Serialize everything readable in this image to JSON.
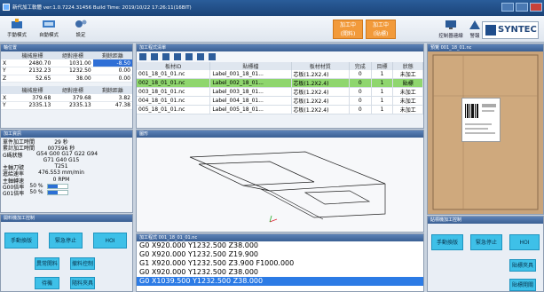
{
  "window": {
    "title": "新代加工軟體 ver:1.0.7224.31456 Build Time: 2019/10/22 17:26:11(16BIT)"
  },
  "toolbar": {
    "buttons": [
      {
        "label": "手動模式",
        "icon": "hand-mode-icon"
      },
      {
        "label": "自動模式",
        "icon": "auto-mode-icon"
      },
      {
        "label": "設定",
        "icon": "gear-icon"
      }
    ],
    "status": [
      {
        "line1": "加工中",
        "line2": "(開料)"
      },
      {
        "label1": "加工中",
        "label2": "(貼標)"
      }
    ],
    "system_buttons": [
      {
        "label": "控制器連線"
      },
      {
        "label": "警報"
      }
    ],
    "logo": "SYNTEC"
  },
  "axis_panel": {
    "title": "軸位置",
    "headers": [
      "",
      "機械座標",
      "絕對座標",
      "剩餘距離"
    ],
    "rows": [
      [
        "X",
        "2480.70",
        "1031.00",
        "-8.50"
      ],
      [
        "Y",
        "2132.23",
        "1232.50",
        "0.00"
      ],
      [
        "Z",
        "52.65",
        "38.00",
        "0.00"
      ]
    ],
    "headers2": [
      "",
      "機械座標",
      "絕對座標",
      "剩餘距離"
    ],
    "rows2": [
      [
        "X",
        "379.68",
        "379.68",
        "3.82"
      ],
      [
        "Y",
        "2335.13",
        "2335.13",
        "47.38"
      ]
    ]
  },
  "process_info": {
    "title": "加工資訊",
    "rows": [
      {
        "k": "單件加工時間",
        "v": "29 秒"
      },
      {
        "k": "累計加工時間",
        "v": "007596 秒"
      },
      {
        "k": "G碼狀態",
        "v": "G54 G00 G17 G22 G94"
      },
      {
        "k": "",
        "v": "G71 G40 G15"
      },
      {
        "k": "主軸刀號",
        "v": "T251"
      },
      {
        "k": "進給速率",
        "v": "476.553 mm/min"
      },
      {
        "k": "主軸轉速",
        "v": "0 RPM"
      },
      {
        "k": "G00倍率",
        "v": "50 %",
        "pct": 50
      },
      {
        "k": "G01倍率",
        "v": "50 %",
        "pct": 50
      }
    ]
  },
  "left_controls": {
    "title": "開料機加工控制",
    "buttons": [
      "手動換版",
      "緊急停止",
      "HOI",
      "異常開料",
      "撤料控制",
      "待機",
      "隨料夾具"
    ]
  },
  "program_list": {
    "title": "加工程式清單",
    "headers": [
      "板材ID",
      "貼標檔",
      "板材材質",
      "完成",
      "目標",
      "狀態"
    ],
    "rows": [
      {
        "id": "001_18_01_01.nc",
        "label": "Label_001_18_01...",
        "mat": "芯板(1.2X2.4)",
        "done": "0",
        "target": "1",
        "status": "未加工",
        "style": "w"
      },
      {
        "id": "002_18_01_01.nc",
        "label": "Label_002_18_01...",
        "mat": "芯板(1.2X2.4)",
        "done": "0",
        "target": "1",
        "status": "貼標",
        "style": "g"
      },
      {
        "id": "003_18_01_01.nc",
        "label": "Label_003_18_01...",
        "mat": "芯板(1.2X2.4)",
        "done": "0",
        "target": "1",
        "status": "未加工",
        "style": "w"
      },
      {
        "id": "004_18_01_01.nc",
        "label": "Label_004_18_01...",
        "mat": "芯板(1.2X2.4)",
        "done": "0",
        "target": "1",
        "status": "未加工",
        "style": "w"
      },
      {
        "id": "005_18_01_01.nc",
        "label": "Label_005_18_01...",
        "mat": "芯板(1.2X2.4)",
        "done": "0",
        "target": "1",
        "status": "未加工",
        "style": "w"
      }
    ]
  },
  "graph_panel": {
    "title": "圖形"
  },
  "gcode_panel": {
    "title": "加工程式 001_18_01_01.nc",
    "lines": [
      "G0 X920.000 Y1232.500 Z38.000",
      "G0 X920.000 Y1232.500 Z19.900",
      "G1 X920.000 Y1232.500 Z3.900 F1000.000",
      "G0 X920.000 Y1232.500 Z38.000",
      "G0 X1039.500 Y1232.500 Z38.000"
    ],
    "selected": 4
  },
  "preview_panel": {
    "title": "預覽 001_18_01.nc"
  },
  "right_controls": {
    "title": "貼標機加工控制",
    "buttons": [
      "手動換版",
      "緊急停止",
      "HOI",
      "貼標夾具",
      "貼標開關"
    ]
  }
}
